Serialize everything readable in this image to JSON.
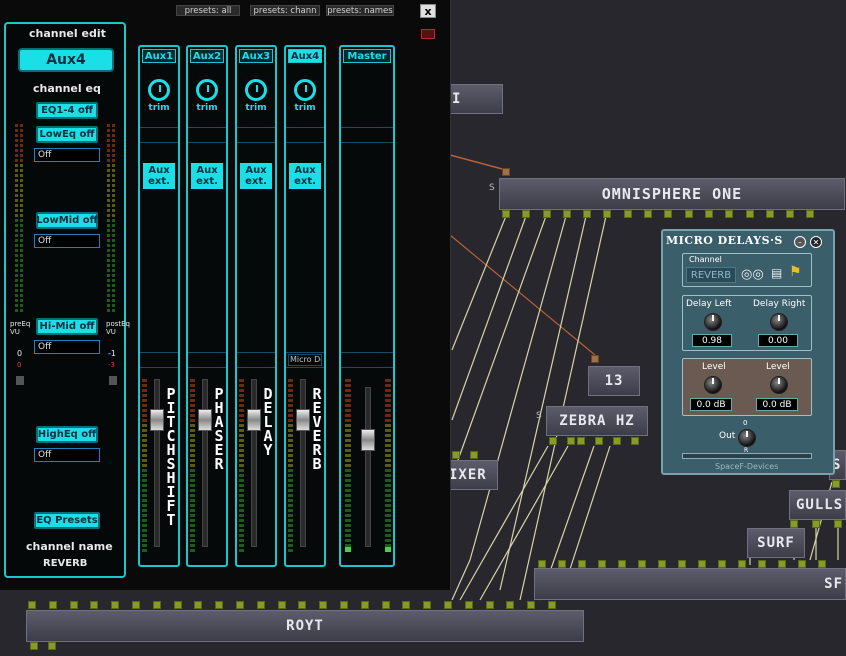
{
  "graph": {
    "nodes": {
      "omnisphere": "OMNISPHERE ONE",
      "zebra": "ZEBRA HZ",
      "n13": "13",
      "mixer": "IXER",
      "gulls": "GULLS",
      "surf": "SURF",
      "royt": "ROYT",
      "sf": "SF",
      "di": "I",
      "s_edge": "S"
    },
    "s_pin_label": "S"
  },
  "window": {
    "presets_all": "presets: all",
    "presets_chann": "presets: chann",
    "presets_names": "presets: names",
    "close": "x"
  },
  "channel_edit": {
    "title": "channel edit",
    "selected": "Aux4",
    "eq_title": "channel eq",
    "buttons": {
      "eq_off": "EQ1-4 off",
      "loweq_off": "LowEq off",
      "lowmid_off": "LowMid off",
      "himid_off": "Hi-Mid off",
      "higheq_off": "HighEq off",
      "eq_presets": "EQ Presets"
    },
    "fields": {
      "loweq": "Off",
      "lowmid": "Off",
      "himid": "Off",
      "higheq": "Off"
    },
    "pre_vu": "preEq VU",
    "post_vu": "postEq VU",
    "pre_val_a": "0",
    "pre_val_b": "0",
    "post_val_a": "-1",
    "post_val_b": "-3",
    "name_label": "channel name",
    "name_value": "REVERB"
  },
  "strips": [
    {
      "label": "Aux1",
      "trim": "trim",
      "aux": "Aux ext.",
      "name": "PITCH SHIFT"
    },
    {
      "label": "Aux2",
      "trim": "trim",
      "aux": "Aux ext.",
      "name": "PHASER"
    },
    {
      "label": "Aux3",
      "trim": "trim",
      "aux": "Aux ext.",
      "name": "DELAY"
    },
    {
      "label": "Aux4",
      "trim": "trim",
      "aux": "Aux ext.",
      "name": "REVERB",
      "insert": "Micro De"
    },
    {
      "label": "Master"
    }
  ],
  "micro_delays": {
    "title": "MICRO DELAYS·S",
    "channel_label": "Channel",
    "channel_value": "REVERB",
    "delay_left_label": "Delay Left",
    "delay_right_label": "Delay Right",
    "delay_left_value": "0.98",
    "delay_right_value": "0.00",
    "level_label_left": "Level",
    "level_label_right": "Level",
    "level_left_value": "0.0 dB",
    "level_right_value": "0.0 dB",
    "out_label": "Out",
    "out_scale_top": "0",
    "out_scale_bottom": "R",
    "brand": "SpaceF-Devices"
  }
}
